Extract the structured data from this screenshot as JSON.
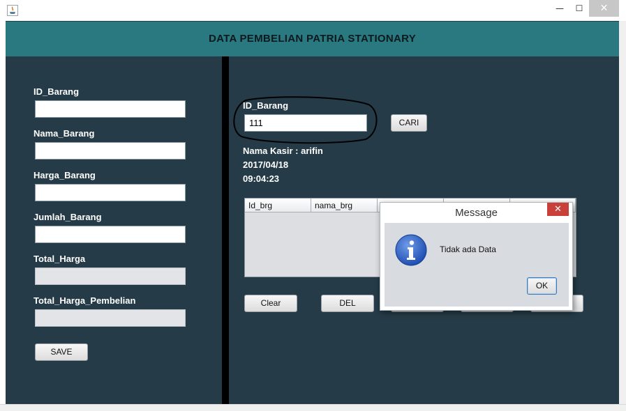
{
  "window": {
    "min_glyph": "—",
    "max_glyph": "☐",
    "close_glyph": "✕"
  },
  "header": {
    "title": "DATA PEMBELIAN PATRIA STATIONARY"
  },
  "left_form": {
    "id_label": "ID_Barang",
    "nama_label": "Nama_Barang",
    "harga_label": "Harga_Barang",
    "jumlah_label": "Jumlah_Barang",
    "total_label": "Total_Harga",
    "total_pembelian_label": "Total_Harga_Pembelian",
    "id_value": "",
    "nama_value": "",
    "harga_value": "",
    "jumlah_value": "",
    "total_value": "",
    "total_pembelian_value": "",
    "save_label": "SAVE"
  },
  "search": {
    "label": "ID_Barang",
    "value": "111",
    "cari_label": "CARI"
  },
  "info": {
    "kasir": "Nama Kasir :  arifin",
    "date": "2017/04/18",
    "time": "09:04:23"
  },
  "table": {
    "columns": [
      "Id_brg",
      "nama_brg",
      "",
      "",
      ""
    ],
    "rows": []
  },
  "actions": {
    "clear_label": "Clear",
    "del_label": "DEL"
  },
  "dialog": {
    "title": "Message",
    "close_glyph": "✕",
    "message": "Tidak ada Data",
    "ok_label": "OK",
    "icon": "info-icon"
  },
  "colors": {
    "header": "#2a7880",
    "panel": "#253b47",
    "divider": "#000000",
    "label_text": "#ffffff"
  }
}
